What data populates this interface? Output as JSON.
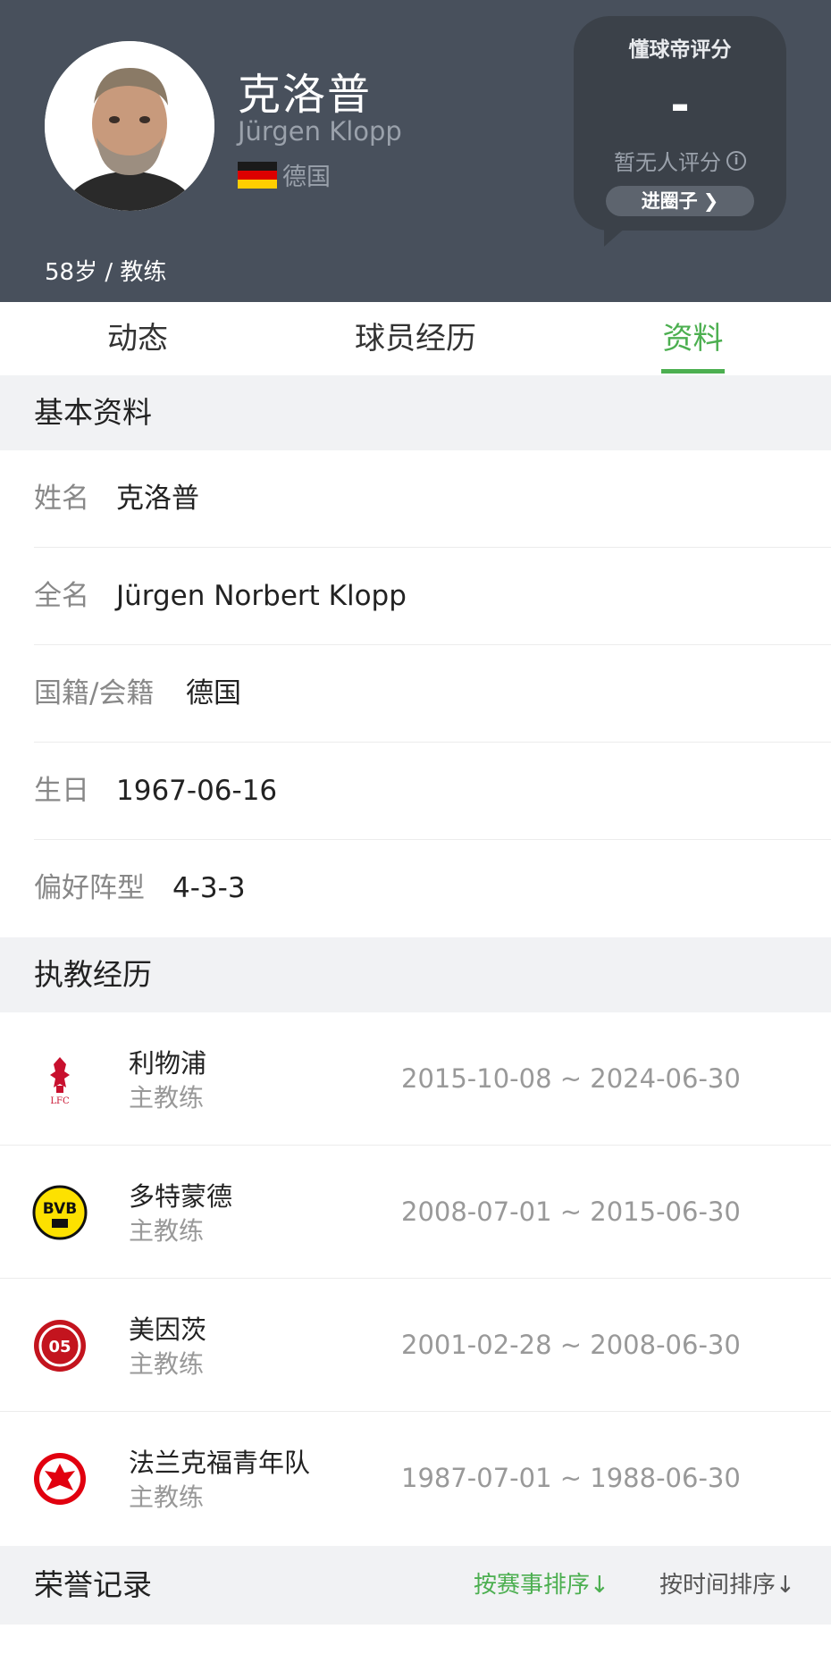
{
  "profile": {
    "cn_name": "克洛普",
    "en_name": "Jürgen Klopp",
    "nationality": "德国",
    "age_role": "58岁 / 教练"
  },
  "rating": {
    "title": "懂球帝评分",
    "score": "-",
    "none_text": "暂无人评分",
    "info_icon_glyph": "i",
    "circle_button": "进圈子",
    "chevron_glyph": "❯"
  },
  "tabs": [
    {
      "label": "动态",
      "active": false
    },
    {
      "label": "球员经历",
      "active": false
    },
    {
      "label": "资料",
      "active": true
    }
  ],
  "basic": {
    "title": "基本资料",
    "rows": [
      {
        "label": "姓名",
        "value": "克洛普"
      },
      {
        "label": "全名",
        "value": "Jürgen Norbert Klopp"
      },
      {
        "label": "国籍/会籍",
        "value": "德国"
      },
      {
        "label": "生日",
        "value": "1967-06-16"
      },
      {
        "label": "偏好阵型",
        "value": "4-3-3"
      }
    ]
  },
  "career": {
    "title": "执教经历",
    "rows": [
      {
        "club": "利物浦",
        "role": "主教练",
        "period": "2015-10-08 ~ 2024-06-30",
        "logo": "liverpool-logo",
        "logo_text": "LFC"
      },
      {
        "club": "多特蒙德",
        "role": "主教练",
        "period": "2008-07-01 ~ 2015-06-30",
        "logo": "dortmund-logo",
        "logo_text": "BVB"
      },
      {
        "club": "美因茨",
        "role": "主教练",
        "period": "2001-02-28 ~ 2008-06-30",
        "logo": "mainz-logo",
        "logo_text": "05"
      },
      {
        "club": "法兰克福青年队",
        "role": "主教练",
        "period": "1987-07-01 ~ 1988-06-30",
        "logo": "frankfurt-logo",
        "logo_text": ""
      }
    ]
  },
  "honors": {
    "title": "荣誉记录",
    "sort_by_event": "按赛事排序↓",
    "sort_by_time": "按时间排序↓"
  },
  "colors": {
    "header_bg": "#48505c",
    "accent_green": "#4caf50",
    "section_bg": "#f1f2f4"
  }
}
